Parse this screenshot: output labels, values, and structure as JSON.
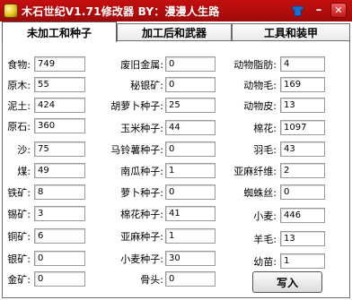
{
  "window": {
    "title": "木石世纪V1.71修改器  BY：漫漫人生路"
  },
  "tabs": [
    "未加工和种子",
    "加工后和武器",
    "工具和装甲"
  ],
  "col1": [
    {
      "label": "食物:",
      "value": "749"
    },
    {
      "label": "原木:",
      "value": "55"
    },
    {
      "label": "泥土:",
      "value": "424"
    },
    {
      "label": "原石:",
      "value": "360"
    },
    {
      "label": "沙:",
      "value": "75"
    },
    {
      "label": "煤:",
      "value": "49"
    },
    {
      "label": "铁矿:",
      "value": "8"
    },
    {
      "label": "锡矿:",
      "value": "3"
    },
    {
      "label": "铜矿:",
      "value": "6"
    },
    {
      "label": "银矿:",
      "value": "0"
    },
    {
      "label": "金矿:",
      "value": "0"
    }
  ],
  "col2": [
    {
      "label": "废旧金属:",
      "value": "0"
    },
    {
      "label": "秘银矿:",
      "value": "0"
    },
    {
      "label": "胡萝卜种子:",
      "value": "25"
    },
    {
      "label": "玉米种子:",
      "value": "44"
    },
    {
      "label": "马铃薯种子:",
      "value": "0"
    },
    {
      "label": "南瓜种子:",
      "value": "1"
    },
    {
      "label": "萝卜种子:",
      "value": "0"
    },
    {
      "label": "棉花种子:",
      "value": "41"
    },
    {
      "label": "亚麻种子:",
      "value": "1"
    },
    {
      "label": "小麦种子:",
      "value": "30"
    },
    {
      "label": "骨头:",
      "value": "0"
    }
  ],
  "col3": [
    {
      "label": "动物脂肪:",
      "value": "4"
    },
    {
      "label": "动物毛:",
      "value": "169"
    },
    {
      "label": "动物皮:",
      "value": "13"
    },
    {
      "label": "棉花:",
      "value": "1097"
    },
    {
      "label": "羽毛:",
      "value": "43"
    },
    {
      "label": "亚麻纤维:",
      "value": "2"
    },
    {
      "label": "蜘蛛丝:",
      "value": "0"
    },
    {
      "label": "小麦:",
      "value": "446"
    },
    {
      "label": "羊毛:",
      "value": "13"
    },
    {
      "label": "幼苗:",
      "value": "1"
    }
  ],
  "buttons": {
    "write": "写入"
  },
  "icons": {
    "app": "gold-coin-icon",
    "skin": "shirt-icon",
    "minimize": "minimize-icon",
    "close": "close-icon"
  },
  "colors": {
    "titlebar": "#b00d0d",
    "skin_icon": "#1b6fd1"
  }
}
